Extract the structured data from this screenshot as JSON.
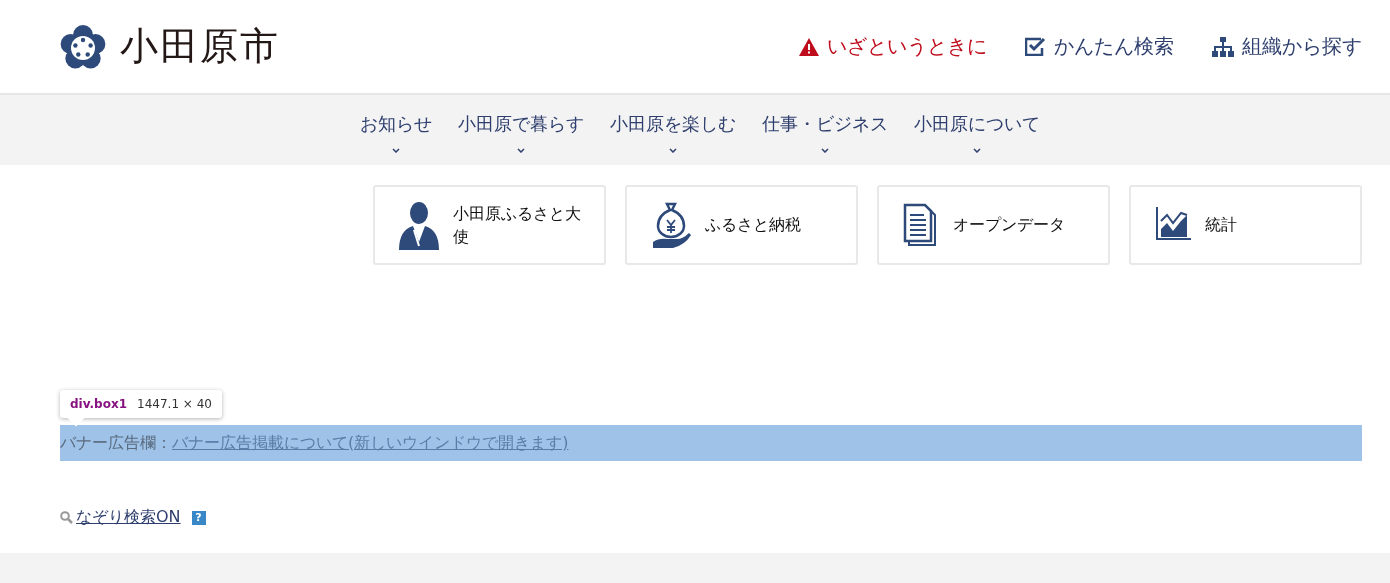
{
  "header": {
    "logo_text": "小田原市",
    "links": [
      {
        "kind": "alert",
        "label": "いざというときに"
      },
      {
        "kind": "check",
        "label": "かんたん検索"
      },
      {
        "kind": "org",
        "label": "組織から探す"
      }
    ]
  },
  "nav": {
    "items": [
      "お知らせ",
      "小田原で暮らす",
      "小田原を楽しむ",
      "仕事・ビジネス",
      "小田原について"
    ]
  },
  "cards": [
    {
      "kind": "person",
      "label": "小田原ふるさと大使"
    },
    {
      "kind": "money",
      "label": "ふるさと納税"
    },
    {
      "kind": "document",
      "label": "オープンデータ"
    },
    {
      "kind": "chart",
      "label": "統計"
    }
  ],
  "devtools_tooltip": {
    "selector": "div.box1",
    "size": "1447.1 × 40"
  },
  "banner": {
    "label": "バナー広告欄：",
    "link": "バナー広告掲載について(新しいウインドウで開きます)"
  },
  "trace_search": {
    "link": "なぞり検索ON",
    "help": "?"
  }
}
